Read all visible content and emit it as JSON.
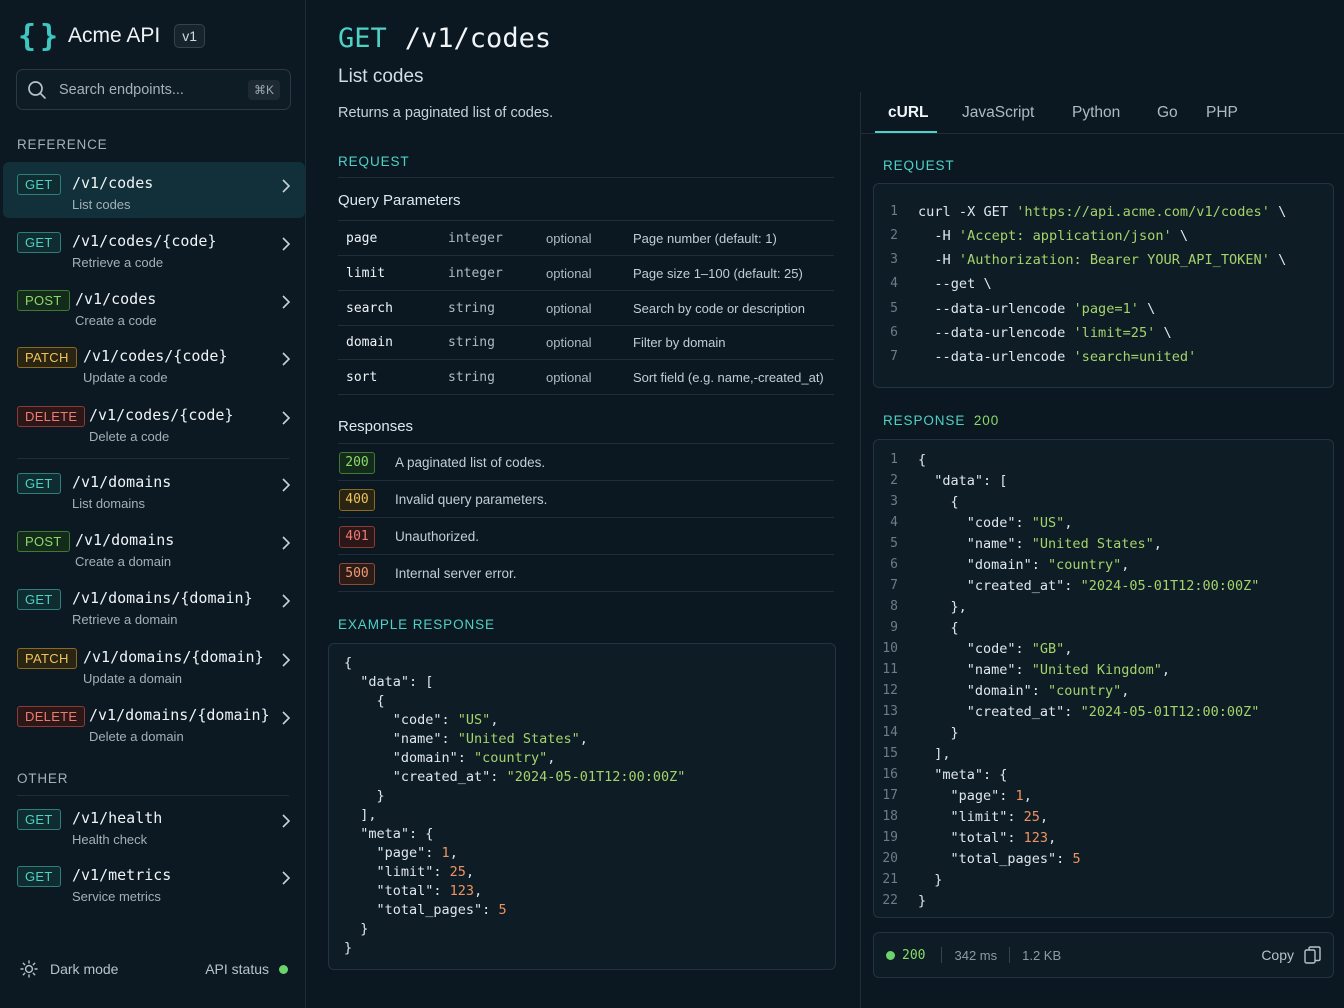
{
  "brand": {
    "name": "Acme API",
    "version": "v1"
  },
  "search": {
    "placeholder": "Search endpoints...",
    "shortcut": "⌘K"
  },
  "sidebar": {
    "reference_label": "REFERENCE",
    "other_label": "OTHER",
    "items": [
      {
        "method": "GET",
        "path": "/v1/codes",
        "desc": "List codes",
        "active": true
      },
      {
        "method": "GET",
        "path": "/v1/codes/{code}",
        "desc": "Retrieve a code"
      },
      {
        "method": "POST",
        "path": "/v1/codes",
        "desc": "Create a code"
      },
      {
        "method": "PATCH",
        "path": "/v1/codes/{code}",
        "desc": "Update a code"
      },
      {
        "method": "DELETE",
        "path": "/v1/codes/{code}",
        "desc": "Delete a code"
      },
      {
        "method": "GET",
        "path": "/v1/domains",
        "desc": "List domains"
      },
      {
        "method": "POST",
        "path": "/v1/domains",
        "desc": "Create a domain"
      },
      {
        "method": "GET",
        "path": "/v1/domains/{domain}",
        "desc": "Retrieve a domain"
      },
      {
        "method": "PATCH",
        "path": "/v1/domains/{domain}",
        "desc": "Update a domain"
      },
      {
        "method": "DELETE",
        "path": "/v1/domains/{domain}",
        "desc": "Delete a domain"
      }
    ],
    "other_items": [
      {
        "method": "GET",
        "path": "/v1/health",
        "desc": "Health check"
      },
      {
        "method": "GET",
        "path": "/v1/metrics",
        "desc": "Service metrics"
      }
    ],
    "footer": {
      "dark_mode": "Dark mode",
      "api_status": "API status",
      "status_color": "#6bd36b"
    }
  },
  "endpoint": {
    "method": "GET",
    "path": "/v1/codes",
    "title": "List codes",
    "description": "Returns a paginated list of codes."
  },
  "request": {
    "heading": "REQUEST",
    "params_heading": "Query Parameters",
    "params": [
      {
        "name": "page",
        "type": "integer",
        "required": "optional",
        "desc": "Page number (default: 1)"
      },
      {
        "name": "limit",
        "type": "integer",
        "required": "optional",
        "desc": "Page size 1–100 (default: 25)"
      },
      {
        "name": "search",
        "type": "string",
        "required": "optional",
        "desc": "Search by code or description"
      },
      {
        "name": "domain",
        "type": "string",
        "required": "optional",
        "desc": "Filter by domain"
      },
      {
        "name": "sort",
        "type": "string",
        "required": "optional",
        "desc": "Sort field (e.g. name,-created_at)"
      }
    ]
  },
  "responses": {
    "heading": "Responses",
    "items": [
      {
        "code": "200",
        "desc": "A paginated list of codes."
      },
      {
        "code": "400",
        "desc": "Invalid query parameters."
      },
      {
        "code": "401",
        "desc": "Unauthorized."
      },
      {
        "code": "500",
        "desc": "Internal server error."
      }
    ]
  },
  "example_response": {
    "heading": "EXAMPLE RESPONSE"
  },
  "code_panel": {
    "tabs": [
      "cURL",
      "JavaScript",
      "Python",
      "Go",
      "PHP"
    ],
    "active_tab": "cURL",
    "request_heading": "REQUEST",
    "response_heading": "RESPONSE",
    "response_code": "200",
    "status": {
      "code": "200",
      "time": "342 ms",
      "size": "1.2 KB",
      "copy": "Copy"
    }
  },
  "colors": {
    "accent": "#4fd1c5",
    "get": "#4fd1c5",
    "post": "#8bd96a",
    "patch": "#f0c35a",
    "delete": "#f07a72",
    "background": "#0b1822"
  }
}
